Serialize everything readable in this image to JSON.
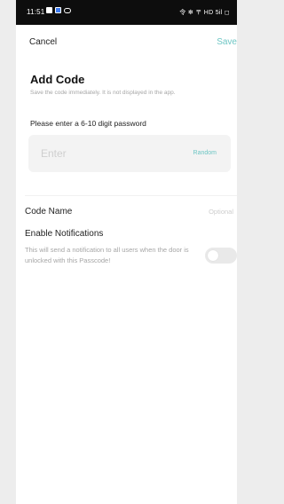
{
  "status_bar": {
    "time": "11:51",
    "right_indicators": "令 ✻ 〒 HD 5il ◻"
  },
  "nav": {
    "cancel_label": "Cancel",
    "save_label": "Save"
  },
  "header": {
    "title": "Add Code",
    "subtitle": "Save the code immediately. It is not displayed in the app."
  },
  "password": {
    "prompt": "Please enter a 6-10 digit password",
    "placeholder": "Enter",
    "value": "",
    "random_label": "Random"
  },
  "code_name": {
    "label": "Code Name",
    "placeholder": "Optional",
    "value": ""
  },
  "notifications": {
    "title": "Enable Notifications",
    "description": "This will send a notification to all users when the door is unlocked with this Passcode!",
    "enabled": false
  },
  "colors": {
    "accent": "#6ec6c4",
    "muted_text": "#a6a6a6",
    "input_bg": "#f3f3f3"
  }
}
